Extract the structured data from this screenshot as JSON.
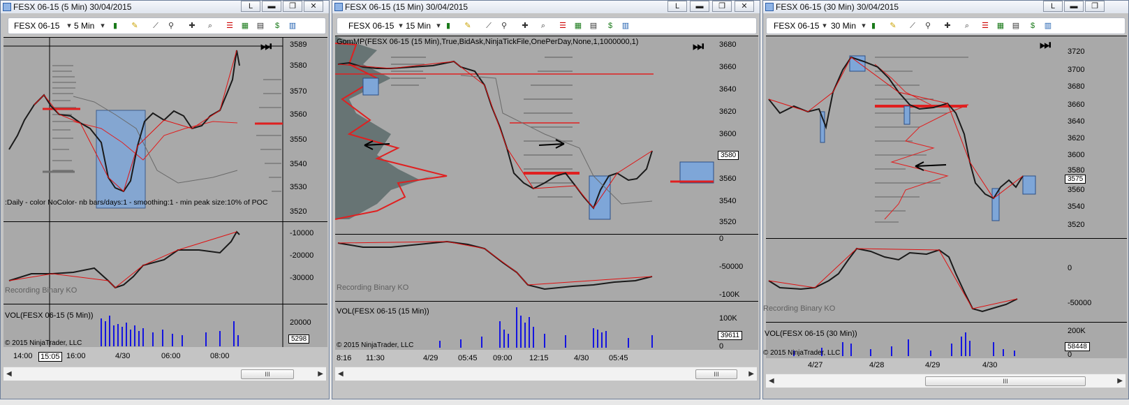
{
  "windows": [
    {
      "title": "FESX 06-15 (5 Min)  30/04/2015",
      "toolbar": {
        "instrument": "FESX 06-15",
        "interval": "5 Min"
      },
      "price_ticks": [
        "3589",
        "3580",
        "3570",
        "3560",
        "3550",
        "3540",
        "3530",
        "3520"
      ],
      "indicator_ticks": [
        "-10000",
        "-20000",
        "-30000"
      ],
      "volume_ticks": [
        "20000",
        "5298"
      ],
      "time_labels": [
        "14:00",
        "15:05",
        "16:00",
        "4/30",
        "06:00",
        "08:00"
      ],
      "profile_label": ":Daily  - color NoColor- nb bars/days:1 - smoothing:1 - min peak size:10% of POC",
      "recording_label": "Recording Binary KO",
      "volume_label": "VOL(FESX 06-15 (5 Min))",
      "copyright": "© 2015 NinjaTrader, LLC",
      "scroll_thumb": "III"
    },
    {
      "title": "FESX 06-15 (15 Min)  30/04/2015",
      "toolbar": {
        "instrument": "FESX 06-15",
        "interval": "15 Min"
      },
      "indicator_title": "GomMP(FESX 06-15 (15 Min),True,BidAsk,NinjaTickFile,OnePerDay,None,1,1000000,1)",
      "price_ticks": [
        "3680",
        "3660",
        "3640",
        "3620",
        "3600",
        "3580",
        "3560",
        "3540",
        "3520"
      ],
      "indicator_ticks": [
        "0",
        "-50000",
        "-100K"
      ],
      "volume_ticks": [
        "100K",
        "39611",
        "0"
      ],
      "time_labels": [
        "8:16",
        "11:30",
        "4/29",
        "05:45",
        "09:00",
        "12:15",
        "4/30",
        "05:45"
      ],
      "recording_label": "Recording Binary KO",
      "volume_label": "VOL(FESX 06-15 (15 Min))",
      "copyright": "© 2015 NinjaTrader, LLC",
      "scroll_thumb": "III"
    },
    {
      "title": "FESX 06-15 (30 Min)  30/04/2015",
      "toolbar": {
        "instrument": "FESX 06-15",
        "interval": "30 Min"
      },
      "price_ticks": [
        "3720",
        "3700",
        "3680",
        "3660",
        "3640",
        "3620",
        "3600",
        "3580",
        "3575",
        "3560",
        "3540",
        "3520"
      ],
      "indicator_ticks": [
        "0",
        "-50000"
      ],
      "volume_ticks": [
        "200K",
        "58448",
        "0"
      ],
      "time_labels": [
        "4/27",
        "4/28",
        "4/29",
        "4/30"
      ],
      "recording_label": "Recording Binary KO",
      "volume_label": "VOL(FESX 06-15 (30 Min))",
      "copyright": "© 2015 NinjaTrader, LLC",
      "scroll_thumb": "III"
    }
  ],
  "colors": {
    "background": "#a9a9a9",
    "up_bar": "#1a7a1a",
    "down_bar": "#e01010",
    "volume": "#1414e0",
    "profile_red": "#e02020",
    "box_fill": "#7ea6d8"
  }
}
